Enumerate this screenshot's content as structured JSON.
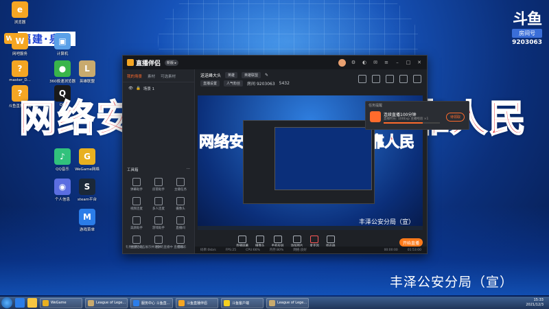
{
  "desktop": {
    "city_logo": "福建·泉州",
    "slogan_left": "网络安",
    "slogan_right": "靠人民",
    "watermark": "丰泽公安分局（宣）",
    "icons": [
      {
        "label": "浏览器",
        "color": "#f5a623",
        "glyph": "e"
      },
      {
        "label": "网吧服务",
        "color": "#f5a623",
        "glyph": "W"
      },
      {
        "label": "计算机",
        "color": "#5aa0e8",
        "glyph": "▣"
      },
      {
        "label": "master_D...",
        "color": "#f5a623",
        "glyph": "?"
      },
      {
        "label": "360极速浏览器",
        "color": "#39b54a",
        "glyph": "●"
      },
      {
        "label": "英雄联盟",
        "color": "#c8aa6e",
        "glyph": "L"
      },
      {
        "label": "斗鱼直播伴侣",
        "color": "#f5a623",
        "glyph": "?"
      },
      {
        "label": "QQ",
        "color": "#1a1a1a",
        "glyph": "Q"
      },
      {
        "label": "QQ音乐",
        "color": "#31c27c",
        "glyph": "♪"
      },
      {
        "label": "WeGame网络",
        "color": "#e8b020",
        "glyph": "G"
      },
      {
        "label": "个人信息",
        "color": "#5b6ee1",
        "glyph": "◉"
      },
      {
        "label": "steam平台",
        "color": "#1b2838",
        "glyph": "S"
      },
      {
        "label": "游戏菜单",
        "color": "#2b7de9",
        "glyph": "M"
      }
    ]
  },
  "douyu": {
    "logo": "斗鱼",
    "room_label": "房间号",
    "room_number": "9203063"
  },
  "app": {
    "brand": "直播伴侣",
    "version_badge": "新版 ▸",
    "sidebar": {
      "tabs": [
        "我的场景",
        "素材",
        "可选素材"
      ],
      "scene": "场景 1",
      "tools_title": "工具箱",
      "tools": [
        "弹幕助手",
        "房管助手",
        "主播任务",
        "视频连麦",
        "多人连麦",
        "摄像头",
        "美颜助手",
        "游戏助手",
        "直播间",
        "主播活动",
        "图片",
        "音乐"
      ],
      "notice": "礼物任务  点击展示并对你的直播中  直播精彩"
    },
    "topbar": {
      "title": "送送峰大头",
      "chip1": "英雄",
      "chip2": "英雄联盟",
      "chip3": "直播设置",
      "chip4": "人气粉丝",
      "room": "房间 9203063",
      "fans": "5432"
    },
    "toast": {
      "head": "任务提醒",
      "title": "连续直播100分钟",
      "sub": "直播时长: 100Exp 主播经验 ×1",
      "progress": 0.7,
      "button": "待领取"
    },
    "preview_watermark": "丰泽公安分局（宣）",
    "controls": [
      "直播屏幕",
      "摄像头",
      "手机投屏",
      "添加图片",
      "麦克风",
      "扬声器"
    ],
    "go_live": "开始直播",
    "status": {
      "bitrate": "码率:0kb/s",
      "fps": "FPS:25",
      "cpu": "CPU:66%",
      "mem": "内存:80%",
      "net": "网络:良好",
      "time1": "00:00:00",
      "time2": "01:53:00"
    }
  },
  "taskbar": {
    "items": [
      {
        "label": "WeGame",
        "color": "#e8b020"
      },
      {
        "label": "League of Lege...",
        "color": "#c8aa6e"
      },
      {
        "label": "服务中心 斗鱼直...",
        "color": "#2b7de9"
      },
      {
        "label": "斗鱼直播伴侣",
        "color": "#f5a623"
      },
      {
        "label": "斗鱼客户端",
        "color": "#f5d020"
      },
      {
        "label": "League of Lege...",
        "color": "#c8aa6e"
      }
    ],
    "time": "15:33",
    "date": "2021/12/3"
  }
}
